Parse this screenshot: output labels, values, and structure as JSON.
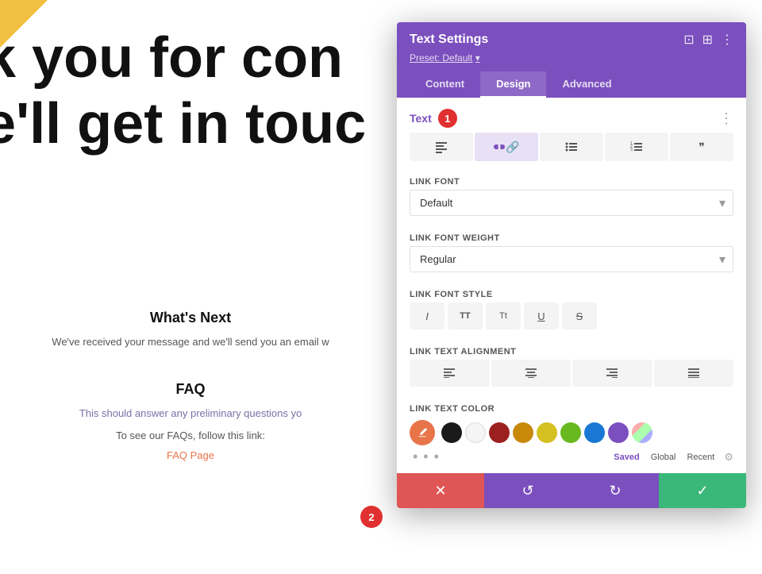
{
  "background": {
    "heading_line1": "k you for con",
    "heading_line2": "e'll get in touc",
    "section1_title": "What's Next",
    "section1_text": "We've received your message and we'll send you an email w",
    "faq_title": "FAQ",
    "faq_text": "This should answer any preliminary questions yo",
    "faq_link_line": "To see our FAQs, follow this link:",
    "faq_page_link": "FAQ Page"
  },
  "modal": {
    "title": "Text Settings",
    "preset_label": "Preset: Default",
    "preset_arrow": "▾",
    "tabs": [
      {
        "label": "Content",
        "active": false
      },
      {
        "label": "Design",
        "active": true
      },
      {
        "label": "Advanced",
        "active": false
      }
    ],
    "section_text_label": "Text",
    "badge1": "1",
    "badge2": "2",
    "style_buttons": [
      {
        "icon": "≡",
        "title": "align-left",
        "active": false
      },
      {
        "icon": "✎",
        "title": "link",
        "active": true
      },
      {
        "icon": "≡",
        "title": "list-unordered",
        "active": false
      },
      {
        "icon": "≡",
        "title": "list-ordered",
        "active": false
      },
      {
        "icon": "❞",
        "title": "blockquote",
        "active": false
      }
    ],
    "link_font_label": "Link Font",
    "link_font_default": "Default",
    "link_font_weight_label": "Link Font Weight",
    "link_font_weight_default": "Regular",
    "link_font_style_label": "Link Font Style",
    "font_style_buttons": [
      "I",
      "TT",
      "Tt",
      "U",
      "S"
    ],
    "link_text_alignment_label": "Link Text Alignment",
    "alignment_buttons": [
      "≡",
      "≡",
      "≡",
      "≡"
    ],
    "link_text_color_label": "Link Text Color",
    "color_swatches": [
      {
        "color": "#1a1a1a",
        "name": "black"
      },
      {
        "color": "#f5f5f5",
        "name": "white"
      },
      {
        "color": "#9b2020",
        "name": "dark-red"
      },
      {
        "color": "#c8880a",
        "name": "orange"
      },
      {
        "color": "#d4c020",
        "name": "yellow"
      },
      {
        "color": "#6ab820",
        "name": "green"
      },
      {
        "color": "#1a78d4",
        "name": "blue"
      },
      {
        "color": "#7b4fbe",
        "name": "purple"
      }
    ],
    "saved_tabs": [
      "Saved",
      "Global",
      "Recent"
    ],
    "active_saved_tab": "Saved",
    "footer_buttons": {
      "cancel": "✕",
      "undo": "↺",
      "redo": "↻",
      "save": "✓"
    }
  }
}
